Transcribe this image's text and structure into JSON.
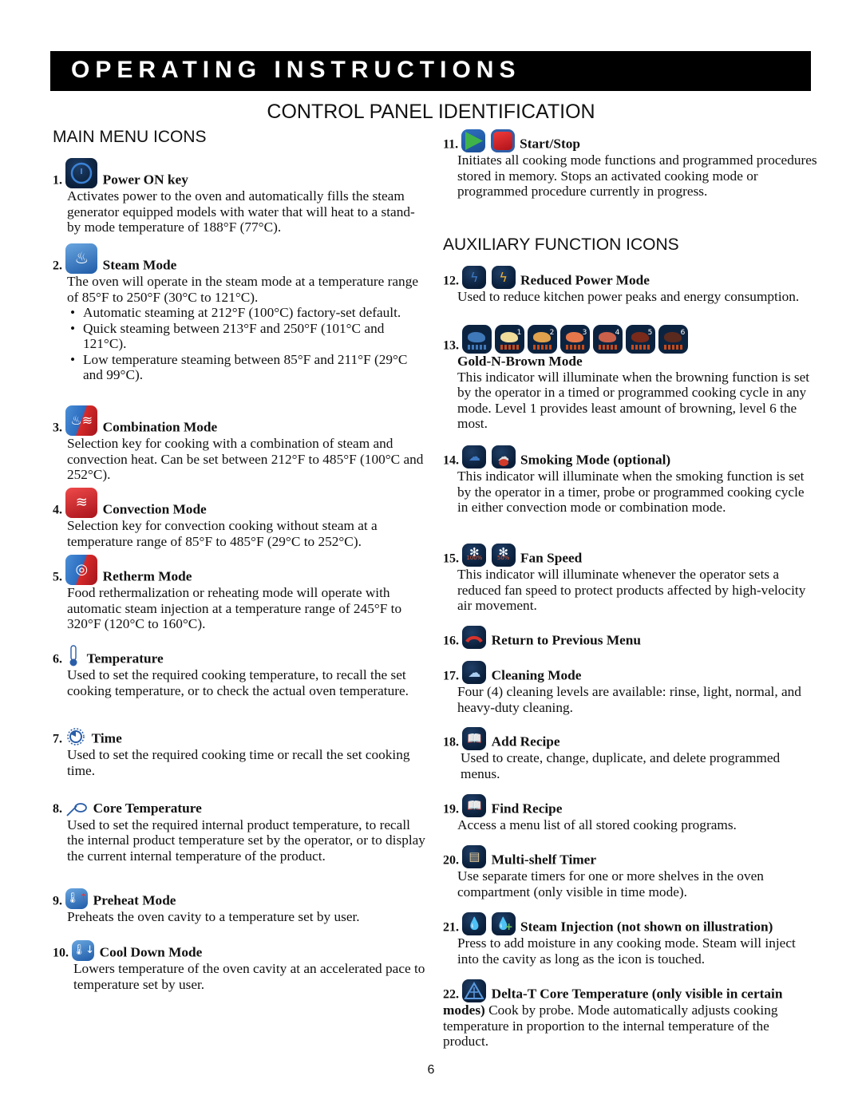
{
  "banner": {
    "title": "OPERATING INSTRUCTIONS"
  },
  "page_title": "CONTROL PANEL IDENTIFICATION",
  "main_menu": {
    "heading": "MAIN MENU ICONS",
    "items": [
      {
        "num": "1.",
        "title": "Power ON key",
        "icon": "power-icon",
        "desc": "Activates power to the oven and automatically fills the steam generator equipped models with water that will heat to a stand-by mode temperature of 188°F (77°C)."
      },
      {
        "num": "2.",
        "title": "Steam Mode",
        "icon": "steam-icon",
        "desc": "The oven will operate in the steam mode at a temperature range of 85°F to 250°F (30°C to 121°C).",
        "bullets": [
          "Automatic steaming at 212°F (100°C) factory-set default.",
          "Quick steaming between 213°F and 250°F (101°C and 121°C).",
          "Low temperature steaming between 85°F and 211°F (29°C and 99°C)."
        ]
      },
      {
        "num": "3.",
        "title": "Combination Mode",
        "icon": "combination-icon",
        "desc": "Selection key for cooking with a combination of steam and convection heat. Can be set between 212°F to 485°F (100°C and 252°C)."
      },
      {
        "num": "4.",
        "title": "Convection Mode",
        "icon": "convection-icon",
        "desc": "Selection key for convection cooking without steam at a temperature range of 85°F to 485°F (29°C to 252°C)."
      },
      {
        "num": "5.",
        "title": "Retherm Mode",
        "icon": "retherm-icon",
        "desc": "Food rethermalization or reheating mode will operate with automatic steam injection at a temperature range of 245°F to 320°F (120°C to 160°C)."
      },
      {
        "num": "6.",
        "title": "Temperature",
        "icon": "thermometer-icon",
        "desc": "Used to set the required cooking temperature, to recall the set cooking temperature, or to check the actual oven temperature."
      },
      {
        "num": "7.",
        "title": "Time",
        "icon": "timer-icon",
        "desc": "Used to set the required cooking time or recall the set cooking time."
      },
      {
        "num": "8.",
        "title": "Core Temperature",
        "icon": "core-probe-icon",
        "desc": "Used to set the required internal product temperature, to recall the internal product temperature set by the operator, or to display the current internal temperature of the product."
      },
      {
        "num": "9.",
        "title": "Preheat Mode",
        "icon": "preheat-icon",
        "desc": "Preheats the oven cavity to a temperature set by user."
      },
      {
        "num": "10.",
        "title": "Cool Down Mode",
        "icon": "cool-down-icon",
        "desc": "Lowers temperature of the oven cavity at an accelerated pace to temperature set by user."
      }
    ]
  },
  "start_stop": {
    "num": "11.",
    "title": "Start/Stop",
    "icons": [
      "start-icon",
      "stop-icon"
    ],
    "desc": "Initiates all cooking mode functions and programmed procedures stored in memory. Stops an activated cooking mode or programmed procedure currently in progress."
  },
  "auxiliary": {
    "heading": "AUXILIARY FUNCTION ICONS",
    "items": [
      {
        "num": "12.",
        "title": "Reduced Power Mode",
        "icons": [
          "power-reduced-off-icon",
          "power-reduced-on-icon"
        ],
        "desc": "Used to reduce kitchen power peaks and energy consumption."
      },
      {
        "num": "13.",
        "title": "Gold-N-Brown Mode",
        "browning_levels": [
          "",
          "1",
          "2",
          "3",
          "4",
          "5",
          "6"
        ],
        "desc": "This indicator will illuminate when the browning function is set by the operator in a timed or programmed cooking cycle in any mode. Level 1 provides least amount of browning, level 6 the most."
      },
      {
        "num": "14.",
        "title": "Smoking Mode (optional)",
        "icons": [
          "smoking-off-icon",
          "smoking-on-icon"
        ],
        "desc": "This indicator will illuminate when the smoking function is set by the operator in a timer, probe or programmed cooking cycle in either convection mode or combination mode."
      },
      {
        "num": "15.",
        "title": "Fan Speed",
        "icons": [
          "fan-100-icon",
          "fan-50-icon"
        ],
        "fan_labels": [
          "100%",
          "50%"
        ],
        "desc": "This indicator will illuminate whenever the operator sets a reduced fan speed to protect products affected by high-velocity air movement."
      },
      {
        "num": "16.",
        "title": "Return to Previous Menu",
        "icons": [
          "return-icon"
        ],
        "desc": ""
      },
      {
        "num": "17.",
        "title": "Cleaning Mode",
        "icons": [
          "cleaning-icon"
        ],
        "desc": "Four (4) cleaning levels are available: rinse, light, normal, and heavy-duty cleaning."
      },
      {
        "num": "18.",
        "title": "Add Recipe",
        "icons": [
          "add-recipe-icon"
        ],
        "desc": "Used to create, change, duplicate, and delete programmed menus."
      },
      {
        "num": "19.",
        "title": "Find Recipe",
        "icons": [
          "find-recipe-icon"
        ],
        "desc": "Access a menu list of all stored cooking programs."
      },
      {
        "num": "20.",
        "title": "Multi-shelf Timer",
        "icons": [
          "multi-shelf-timer-icon"
        ],
        "desc": "Use separate timers for one or more shelves in the oven compartment (only visible in time mode)."
      },
      {
        "num": "21.",
        "title": "Steam Injection (not shown on illustration)",
        "icons": [
          "steam-injection-off-icon",
          "steam-injection-on-icon"
        ],
        "desc": "Press to add moisture in any cooking mode. Steam will inject into the cavity as long as the icon is touched."
      },
      {
        "num": "22.",
        "title": "Delta-T Core Temperature (only visible in certain modes)",
        "icons": [
          "delta-t-icon"
        ],
        "desc": "Cook by probe. Mode automatically adjusts cooking temperature in proportion to the internal temperature of the product."
      }
    ]
  },
  "page_number": "6"
}
